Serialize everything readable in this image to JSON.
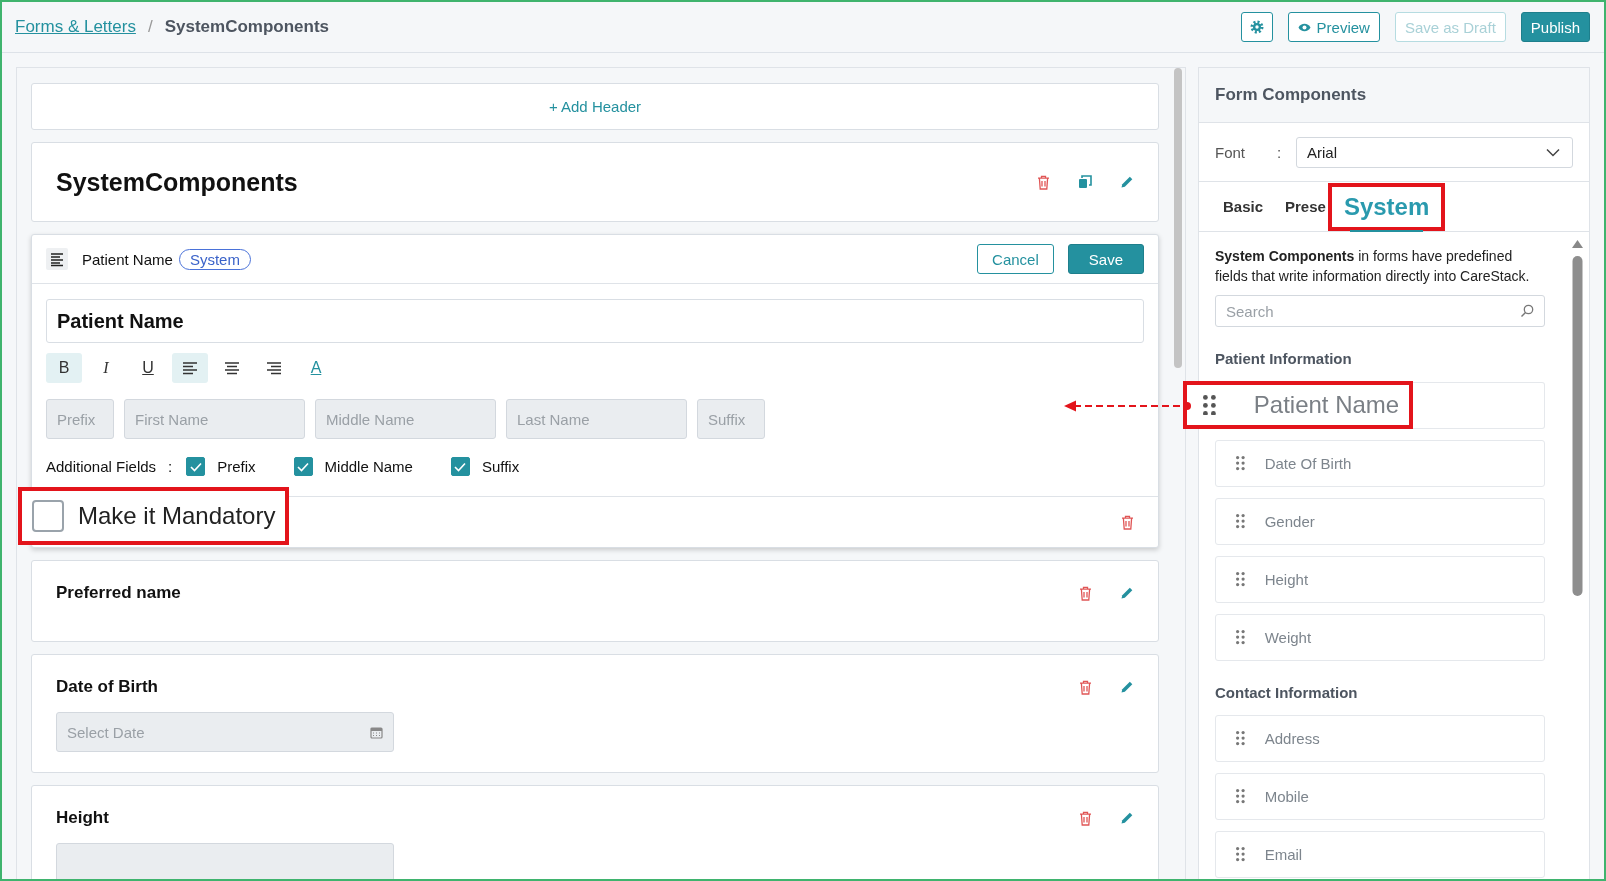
{
  "breadcrumb": [
    {
      "label": "Forms & Letters",
      "kind": "link"
    },
    {
      "label": "/",
      "kind": "separator"
    },
    {
      "label": "SystemComponents",
      "kind": "current"
    }
  ],
  "toolbar": [
    {
      "kind": "icon",
      "disabled": false
    },
    {
      "kind": "outline",
      "label": "Preview",
      "disabled": false
    },
    {
      "kind": "outline",
      "label": "Save as Draft",
      "disabled": true
    },
    {
      "kind": "primary",
      "label": "Publish",
      "disabled": false
    }
  ],
  "add_header": "+ Add Header",
  "form_title": "SystemComponents",
  "editor": {
    "type_label": "Patient Name",
    "tag": "System",
    "cancel": "Cancel",
    "save": "Save",
    "title_value": "Patient Name",
    "format_buttons": [
      {
        "kind": "glyph",
        "glyph": "B",
        "selected": true
      },
      {
        "kind": "glyph",
        "glyph": "I",
        "selected": false
      },
      {
        "kind": "glyph",
        "glyph": "U",
        "selected": false
      },
      {
        "kind": "align",
        "selected": true
      },
      {
        "kind": "align",
        "selected": false
      },
      {
        "kind": "align",
        "selected": false
      },
      {
        "kind": "glyph",
        "glyph": "A",
        "selected": false
      }
    ],
    "name_fields": [
      {
        "placeholder": "Prefix"
      },
      {
        "placeholder": "First Name"
      },
      {
        "placeholder": "Middle Name"
      },
      {
        "placeholder": "Last Name"
      },
      {
        "placeholder": "Suffix"
      }
    ],
    "additional_label": "Additional Fields",
    "additional_colon": ":",
    "additional_options": [
      {
        "label": "Prefix",
        "checked": true
      },
      {
        "label": "Middle Name",
        "checked": true
      },
      {
        "label": "Suffix",
        "checked": true
      }
    ],
    "mandatory": {
      "label": "Make it Mandatory",
      "checked": false,
      "highlighted": true
    }
  },
  "fields": [
    {
      "title": "Preferred name",
      "kind": "text"
    },
    {
      "title": "Date of Birth",
      "kind": "date",
      "placeholder": "Select Date"
    },
    {
      "title": "Height",
      "kind": "measure"
    }
  ],
  "panel": {
    "title": "Form Components",
    "font_label": "Font",
    "font_colon": ":",
    "font_value": "Arial",
    "tabs": [
      {
        "label": "Basic",
        "selected": false,
        "highlighted": false
      },
      {
        "label": "Prese",
        "selected": false,
        "highlighted": false
      },
      {
        "label": "System",
        "selected": true,
        "highlighted": true
      }
    ],
    "description": "**System Components** in forms have predefined fields that write information directly into CareStack.",
    "search_placeholder": "Search",
    "groups": [
      {
        "title": "Patient Information",
        "items": [
          {
            "label": "Patient Name",
            "highlighted": true
          },
          {
            "label": "Date Of Birth",
            "highlighted": false
          },
          {
            "label": "Gender",
            "highlighted": false
          },
          {
            "label": "Height",
            "highlighted": false
          },
          {
            "label": "Weight",
            "highlighted": false
          }
        ]
      },
      {
        "title": "Contact Information",
        "items": [
          {
            "label": "Address",
            "highlighted": false
          },
          {
            "label": "Mobile",
            "highlighted": false
          },
          {
            "label": "Email",
            "highlighted": false
          }
        ]
      }
    ]
  }
}
